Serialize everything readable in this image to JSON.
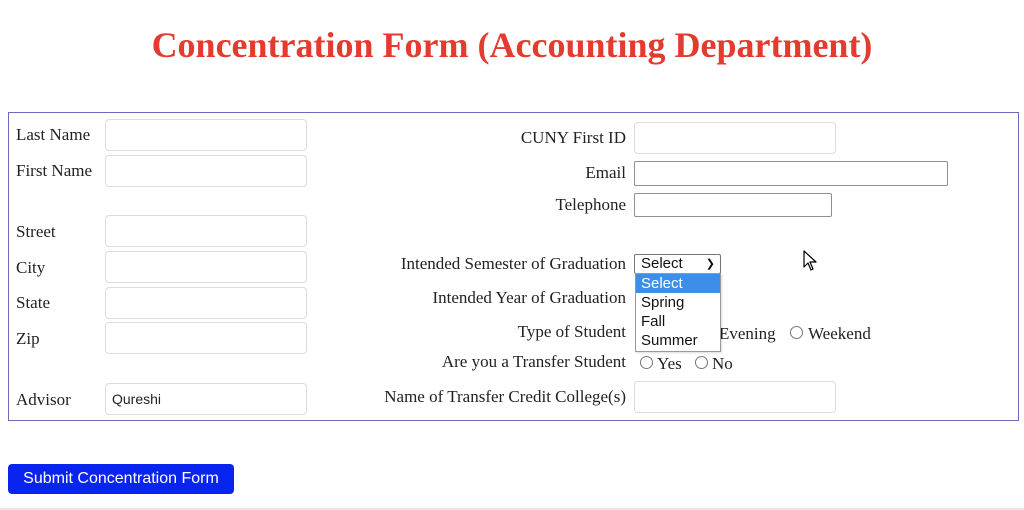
{
  "page": {
    "title": "Concentration Form (Accounting Department)"
  },
  "left_fields": {
    "last_name": {
      "label": "Last Name",
      "value": ""
    },
    "first_name": {
      "label": "First Name",
      "value": ""
    },
    "street": {
      "label": "Street",
      "value": ""
    },
    "city": {
      "label": "City",
      "value": ""
    },
    "state": {
      "label": "State",
      "value": ""
    },
    "zip": {
      "label": "Zip",
      "value": ""
    },
    "advisor": {
      "label": "Advisor",
      "value": "Qureshi"
    }
  },
  "right_fields": {
    "cuny_id": {
      "label": "CUNY First ID",
      "value": ""
    },
    "email": {
      "label": "Email",
      "value": ""
    },
    "telephone": {
      "label": "Telephone",
      "value": ""
    },
    "semester": {
      "label": "Intended Semester of Graduation",
      "selected": "Select",
      "options": [
        "Select",
        "Spring",
        "Fall",
        "Summer"
      ]
    },
    "year": {
      "label": "Intended Year of Graduation"
    },
    "student_type": {
      "label": "Type of Student",
      "options": [
        "Evening",
        "Weekend"
      ]
    },
    "transfer": {
      "label": "Are you a Transfer Student",
      "options": [
        "Yes",
        "No"
      ]
    },
    "transfer_college": {
      "label": "Name of Transfer Credit College(s)",
      "value": ""
    }
  },
  "actions": {
    "submit_label": "Submit Concentration Form"
  },
  "colors": {
    "title": "#e43a2f",
    "form_border": "#6b6bbd",
    "submit_bg": "#0a24f0",
    "option_highlight": "#3d8ee8"
  }
}
